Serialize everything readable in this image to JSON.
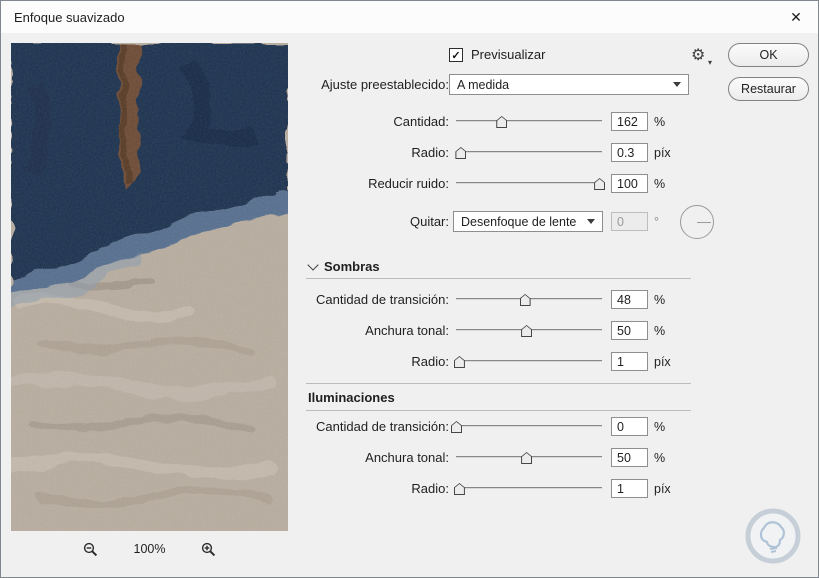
{
  "window": {
    "title": "Enfoque suavizado"
  },
  "icons": {
    "close": "✕",
    "check": "✓",
    "gear": "⚙",
    "menu_caret": "▾"
  },
  "colors": {
    "dialog_bg": "#f0f0f0",
    "titlebar_bg": "#fcfcfc",
    "track": "#878787"
  },
  "buttons": {
    "ok": "OK",
    "restore": "Restaurar"
  },
  "top": {
    "preview_checkbox": "Previsualizar",
    "preview_checked": true,
    "preset_label": "Ajuste preestablecido:",
    "preset_value": "A medida"
  },
  "main_sliders": [
    {
      "label": "Cantidad:",
      "value": "162",
      "unit": "%",
      "pct": 31
    },
    {
      "label": "Radio:",
      "value": "0.3",
      "unit": "píx",
      "pct": 3
    },
    {
      "label": "Reducir ruido:",
      "value": "100",
      "unit": "%",
      "pct": 98
    }
  ],
  "remove": {
    "label": "Quitar:",
    "value": "Desenfoque de lente",
    "angle_value": "0",
    "angle_unit": "°"
  },
  "shadows": {
    "header": "Sombras",
    "sliders": [
      {
        "label": "Cantidad de transición:",
        "value": "48",
        "unit": "%",
        "pct": 47
      },
      {
        "label": "Anchura tonal:",
        "value": "50",
        "unit": "%",
        "pct": 48
      },
      {
        "label": "Radio:",
        "value": "1",
        "unit": "píx",
        "pct": 2
      }
    ]
  },
  "highlights": {
    "header": "Iluminaciones",
    "sliders": [
      {
        "label": "Cantidad de transición:",
        "value": "0",
        "unit": "%",
        "pct": 0
      },
      {
        "label": "Anchura tonal:",
        "value": "50",
        "unit": "%",
        "pct": 48
      },
      {
        "label": "Radio:",
        "value": "1",
        "unit": "píx",
        "pct": 2
      }
    ]
  },
  "zoom": {
    "level": "100%"
  }
}
